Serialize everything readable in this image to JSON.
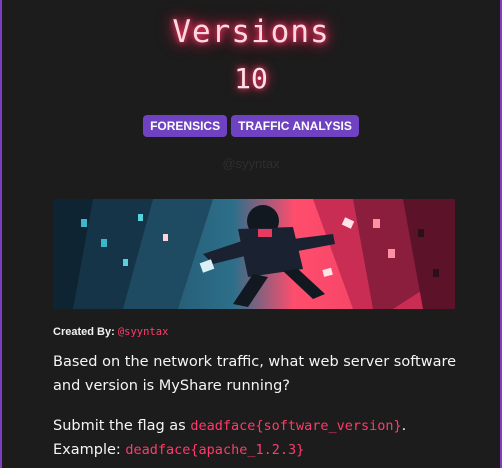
{
  "challenge": {
    "title": "Versions",
    "points": "10",
    "tags": [
      "FORENSICS",
      "TRAFFIC ANALYSIS"
    ],
    "watermark": "@syyntax",
    "created_by_label": "Created By:",
    "author": "@syyntax",
    "question": "Based on the network traffic, what web server software and version is MyShare running?",
    "submit_prefix": "Submit the flag as",
    "flag_format": "deadface{software_version}",
    "submit_suffix": ".",
    "example_label": "Example:",
    "example_flag": "deadface{apache_1.2.3}"
  },
  "colors": {
    "accent_pink": "#ff3b6b",
    "tag_purple": "#6f42c1",
    "background": "#1c1c1c",
    "border_purple": "#7d3fbf"
  },
  "icons": {
    "banner": "hooded-hacker-falling-illustration"
  }
}
